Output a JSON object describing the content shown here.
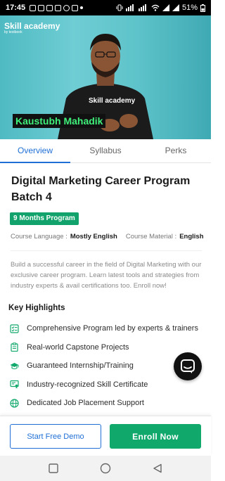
{
  "status_bar": {
    "time": "17:45",
    "battery": "51%"
  },
  "video": {
    "brand_name": "Skill academy",
    "brand_sub": "by testbook",
    "speaker_name": "Kaustubh Mahadik",
    "shirt_text": "Skill academy"
  },
  "tabs": [
    {
      "label": "Overview",
      "active": true
    },
    {
      "label": "Syllabus",
      "active": false
    },
    {
      "label": "Perks",
      "active": false
    }
  ],
  "course": {
    "title": "Digital Marketing Career Program Batch 4",
    "duration_badge": "9 Months Program",
    "language_label": "Course Language :",
    "language_value": "Mostly English",
    "material_label": "Course Material :",
    "material_value": "English",
    "description": "Build a successful career in the field of Digital Marketing with our exclusive career program. Learn latest tools and strategies from industry experts & avail certifications too. Enroll now!",
    "accent_color": "#10a86b"
  },
  "highlights": {
    "title": "Key Highlights",
    "items": [
      {
        "label": "Comprehensive Program led by experts & trainers",
        "icon": "checklist-icon"
      },
      {
        "label": "Real-world Capstone Projects",
        "icon": "clipboard-icon"
      },
      {
        "label": "Guaranteed Internship/Training",
        "icon": "graduation-cap-icon"
      },
      {
        "label": "Industry-recognized Skill Certificate",
        "icon": "certificate-icon"
      },
      {
        "label": "Dedicated Job Placement Support",
        "icon": "globe-icon"
      }
    ]
  },
  "cta": {
    "demo_label": "Start Free Demo",
    "enroll_label": "Enroll Now"
  }
}
